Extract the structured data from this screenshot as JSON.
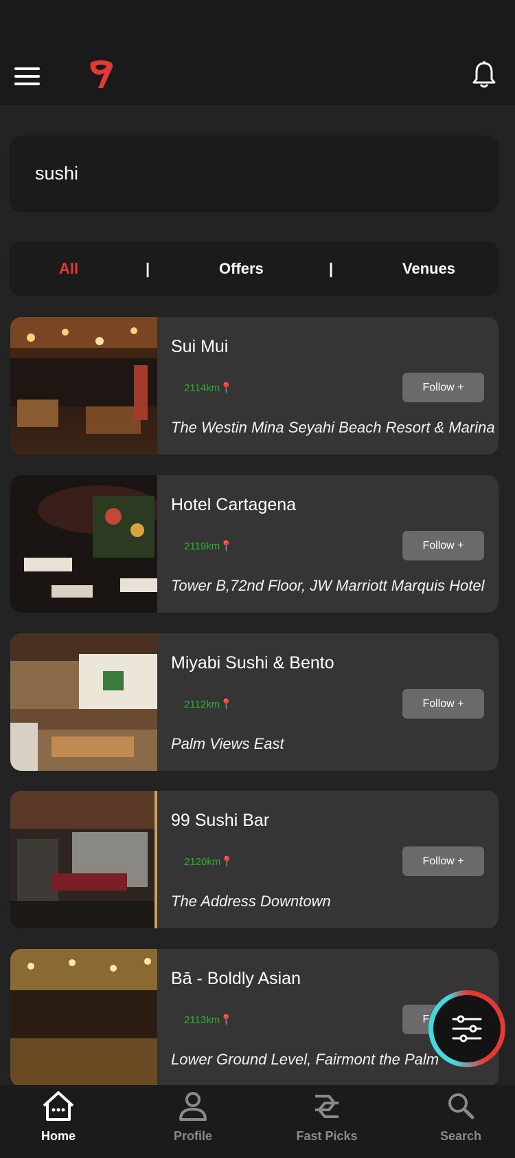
{
  "search": {
    "query": "sushi"
  },
  "filter_tabs": [
    {
      "label": "All",
      "active": true
    },
    {
      "label": "Offers",
      "active": false
    },
    {
      "label": "Venues",
      "active": false
    }
  ],
  "separator": "|",
  "venues": [
    {
      "name": "Sui Mui",
      "distance": "2114km",
      "address": "The Westin Mina Seyahi Beach Resort & Marina",
      "follow_label": "Follow +"
    },
    {
      "name": "Hotel Cartagena",
      "distance": "2119km",
      "address": "Tower B,72nd Floor,  JW Marriott Marquis Hotel",
      "follow_label": "Follow +"
    },
    {
      "name": "Miyabi Sushi & Bento",
      "distance": "2112km",
      "address": "Palm Views East",
      "follow_label": "Follow +"
    },
    {
      "name": "99 Sushi Bar",
      "distance": "2120km",
      "address": "The Address Downtown",
      "follow_label": "Follow +"
    },
    {
      "name": "Bā - Boldly Asian",
      "distance": "2113km",
      "address": "Lower Ground Level, Fairmont the Palm",
      "follow_label": "Follow +"
    }
  ],
  "bottom_nav": [
    {
      "label": "Home",
      "icon": "home-icon",
      "active": true
    },
    {
      "label": "Profile",
      "icon": "profile-icon",
      "active": false
    },
    {
      "label": "Fast Picks",
      "icon": "fast-picks-icon",
      "active": false
    },
    {
      "label": "Search",
      "icon": "search-icon",
      "active": false
    }
  ],
  "colors": {
    "accent": "#e53935",
    "distance": "#2faf2f",
    "inactive": "#8a8a8a",
    "fab_ring": "#46d6de"
  }
}
